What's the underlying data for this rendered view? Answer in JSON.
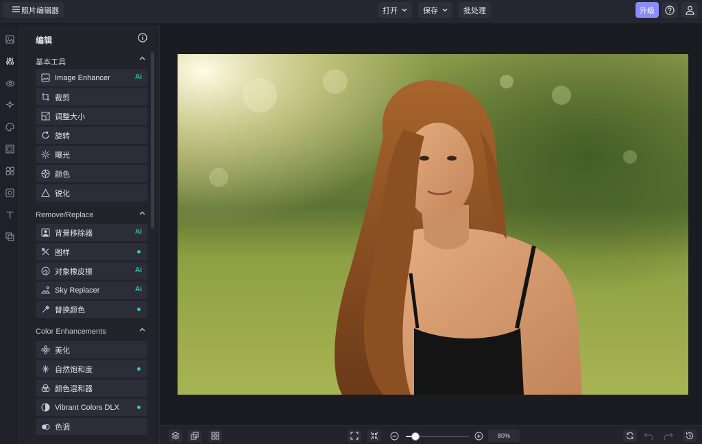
{
  "app": {
    "title": "照片编辑器"
  },
  "toolbar": {
    "open_label": "打开",
    "save_label": "保存",
    "batch_label": "批处理",
    "upgrade_label": "升级"
  },
  "panel": {
    "title": "编辑",
    "sections": [
      {
        "title": "基本工具",
        "items": [
          {
            "label": "Image Enhancer",
            "badge": "Ai"
          },
          {
            "label": "裁剪"
          },
          {
            "label": "调整大小"
          },
          {
            "label": "旋转"
          },
          {
            "label": "曝光"
          },
          {
            "label": "颜色"
          },
          {
            "label": "锐化"
          }
        ]
      },
      {
        "title": "Remove/Replace",
        "items": [
          {
            "label": "背景移除器",
            "badge": "Ai"
          },
          {
            "label": "图样",
            "badge": "dot"
          },
          {
            "label": "对象橡皮擦",
            "badge": "Ai"
          },
          {
            "label": "Sky Replacer",
            "badge": "Ai"
          },
          {
            "label": "替换颜色",
            "badge": "dot"
          }
        ]
      },
      {
        "title": "Color Enhancements",
        "items": [
          {
            "label": "美化"
          },
          {
            "label": "自然饱和度",
            "badge": "dot"
          },
          {
            "label": "颜色混和器"
          },
          {
            "label": "Vibrant Colors DLX",
            "badge": "dot"
          },
          {
            "label": "色调"
          }
        ]
      }
    ]
  },
  "zoom": {
    "value": "80%",
    "level": 0.15
  },
  "colors": {
    "accent": "#8a8cf7",
    "ai_badge": "#33c4a8",
    "dot": "#2ecfb0"
  }
}
